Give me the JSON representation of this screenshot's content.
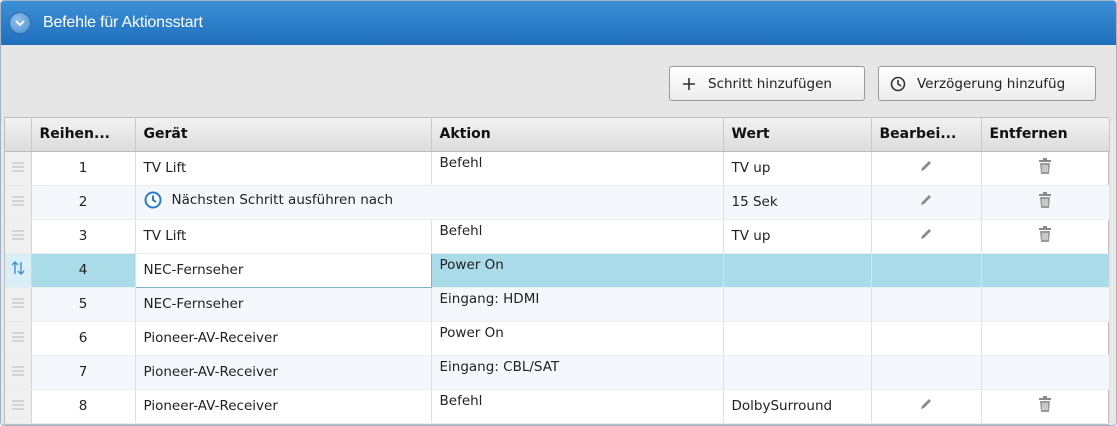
{
  "panel": {
    "title": "Befehle für Aktionsstart"
  },
  "toolbar": {
    "add_step_label": "Schritt hinzufügen",
    "add_delay_label": "Verzögerung hinzufüg"
  },
  "table": {
    "columns": {
      "order": "Reihen...",
      "device": "Gerät",
      "action": "Aktion",
      "value": "Wert",
      "edit": "Bearbei...",
      "remove": "Entfernen"
    },
    "rows": [
      {
        "num": "1",
        "device": "TV Lift",
        "action": "Befehl",
        "value": "TV up"
      },
      {
        "num": "2",
        "delay_text": "Nächsten Schritt ausführen nach",
        "value": "15 Sek"
      },
      {
        "num": "3",
        "device": "TV Lift",
        "action": "Befehl",
        "value": "TV up"
      },
      {
        "num": "4",
        "device": "NEC-Fernseher",
        "action": "Power On",
        "value": ""
      },
      {
        "num": "5",
        "device": "NEC-Fernseher",
        "action": "Eingang: HDMI",
        "value": ""
      },
      {
        "num": "6",
        "device": "Pioneer-AV-Receiver",
        "action": "Power On",
        "value": ""
      },
      {
        "num": "7",
        "device": "Pioneer-AV-Receiver",
        "action": "Eingang: CBL/SAT",
        "value": ""
      },
      {
        "num": "8",
        "device": "Pioneer-AV-Receiver",
        "action": "Befehl",
        "value": "DolbySurround"
      }
    ]
  },
  "icons": {
    "collapse": "chevron-down-icon",
    "add": "plus-icon",
    "delay": "clock-icon",
    "drag": "drag-handle-icon",
    "move": "move-updown-icon",
    "edit": "pencil-icon",
    "remove": "trash-icon"
  },
  "colors": {
    "header_blue": "#2a7dcb",
    "selected_row": "#a9dbe9",
    "clock_blue": "#2a7dcb"
  }
}
